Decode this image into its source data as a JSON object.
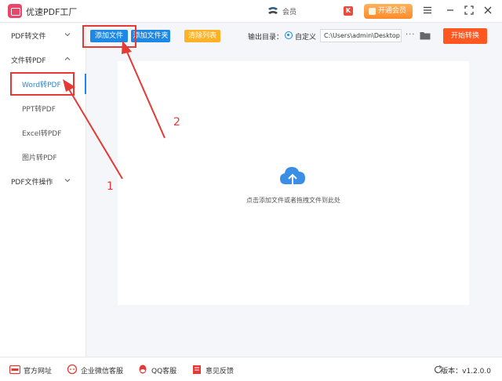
{
  "app": {
    "title": "优速PDF工厂"
  },
  "titlebar": {
    "ad_text": "会员",
    "promo_badge": "K",
    "vip_label": "开通会员"
  },
  "sidebar": {
    "groups": [
      {
        "label": "PDF转文件"
      },
      {
        "label": "文件转PDF"
      },
      {
        "label": "PDF文件操作"
      }
    ],
    "items": [
      {
        "label": "Word转PDF",
        "active": true
      },
      {
        "label": "PPT转PDF"
      },
      {
        "label": "Excel转PDF"
      },
      {
        "label": "图片转PDF"
      }
    ]
  },
  "toolbar": {
    "add_file": "添加文件",
    "add_folder": "添加文件夹",
    "clear_list": "清除列表",
    "output_label": "输出目录：",
    "radio_label": "自定义",
    "output_path": "C:\\Users\\admin\\Desktop",
    "more": "···",
    "start": "开始转换"
  },
  "main": {
    "drop_hint": "点击添加文件或者拖拽文件到此处"
  },
  "annotations": {
    "num1": "1",
    "num2": "2"
  },
  "footer": {
    "website": "官方网址",
    "wechat": "企业微信客服",
    "qq": "QQ客服",
    "feedback": "意见反馈",
    "version": "版本：v1.2.0.0"
  },
  "colors": {
    "accent": "#1e88e5",
    "start": "#ff5722",
    "clear": "#ffb226",
    "annotation": "#e53935"
  }
}
